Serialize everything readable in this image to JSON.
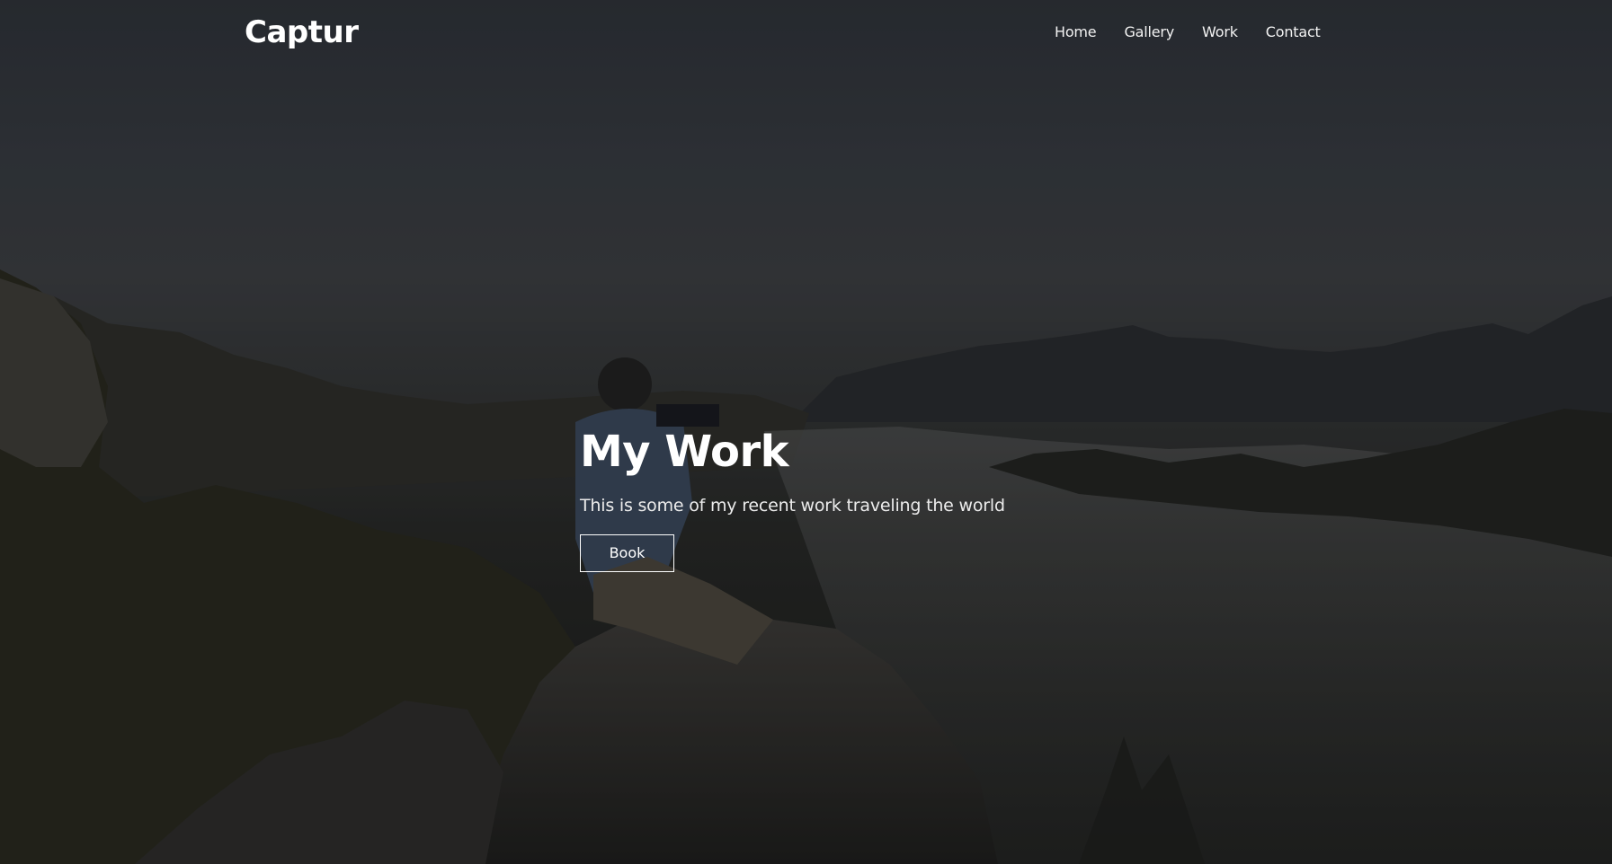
{
  "brand": {
    "name": "Captur"
  },
  "nav": {
    "items": [
      {
        "label": "Home"
      },
      {
        "label": "Gallery"
      },
      {
        "label": "Work"
      },
      {
        "label": "Contact"
      }
    ]
  },
  "hero": {
    "title": "My Work",
    "subtitle": "This is some of my recent work traveling the world",
    "button_label": "Book"
  },
  "colors": {
    "text": "#ffffff",
    "overlay": "#14161a"
  }
}
